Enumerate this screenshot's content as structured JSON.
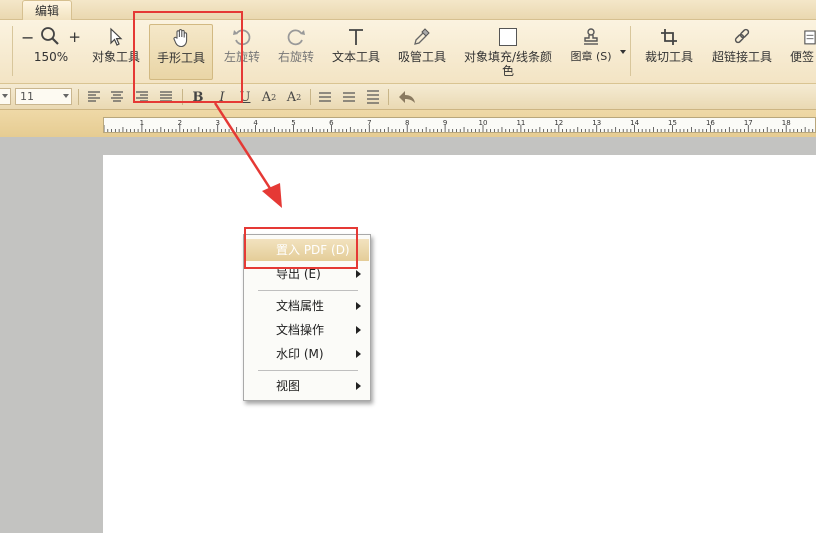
{
  "tabs": {
    "active": "编辑"
  },
  "toolbar": {
    "zoom_minus": "−",
    "zoom_value": "150%",
    "zoom_plus": "+",
    "object_tool": "对象工具",
    "hand_tool": "手形工具",
    "rotate_left": "左旋转",
    "rotate_right": "右旋转",
    "text_tool": "文本工具",
    "eyedropper_tool": "吸管工具",
    "fill_line_color": "对象填充/线条颜色",
    "stamp": "图章 (S)",
    "crop_tool": "裁切工具",
    "hyperlink_tool": "超链接工具",
    "note_tool": "便签"
  },
  "format_bar": {
    "font_size": "11",
    "bold": "B",
    "italic": "I",
    "underline": "U",
    "superscript": "A",
    "superscript_mark": "2",
    "subscript": "A",
    "subscript_mark": "2"
  },
  "ruler": {
    "labels": [
      "1",
      "2",
      "3",
      "4",
      "5",
      "6",
      "7",
      "8",
      "9",
      "10",
      "11",
      "12",
      "13",
      "14",
      "15",
      "16",
      "17",
      "18"
    ]
  },
  "context_menu": {
    "items": [
      {
        "label": "置入 PDF (D)",
        "highlighted": true,
        "has_submenu": false
      },
      {
        "label": "导出 (E)",
        "highlighted": false,
        "has_submenu": true
      },
      {
        "label": "文档属性",
        "highlighted": false,
        "has_submenu": true
      },
      {
        "label": "文档操作",
        "highlighted": false,
        "has_submenu": true
      },
      {
        "label": "水印 (M)",
        "highlighted": false,
        "has_submenu": true
      },
      {
        "label": "视图",
        "highlighted": false,
        "has_submenu": true
      }
    ]
  },
  "colors": {
    "annotation": "#e53935",
    "ribbon_top": "#fbf3e0",
    "ribbon_bottom": "#f3e4c4",
    "highlight": "#e4cd98",
    "workspace": "#c3c3c1"
  }
}
